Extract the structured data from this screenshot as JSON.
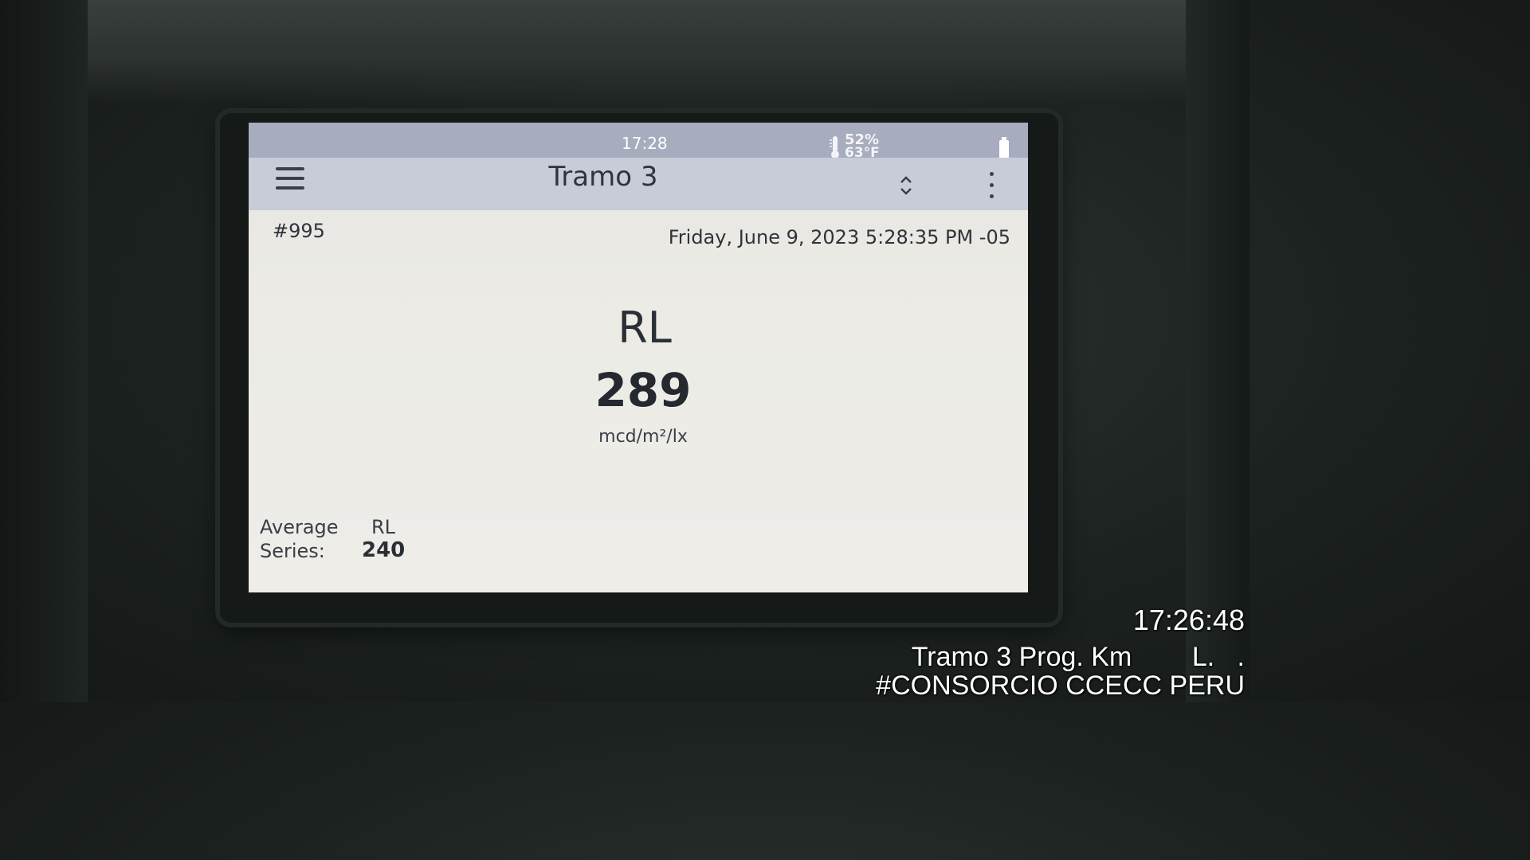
{
  "device": {
    "status_bar": {
      "time": "17:28",
      "humidity": "52%",
      "temperature": "63°F",
      "icons": [
        "thermometer-icon",
        "battery-icon"
      ]
    },
    "app_bar": {
      "title": "Tramo 3",
      "icons": [
        "menu-icon",
        "sort-icon",
        "more-vert-icon"
      ]
    },
    "measurement": {
      "record_id": "#995",
      "timestamp": "Friday, June 9, 2023 5:28:35 PM -05",
      "metric": "RL",
      "value": "289",
      "unit": "mcd/m²/lx"
    },
    "series_average": {
      "label_line1": "Average",
      "label_line2": "Series:",
      "column": "RL",
      "value": "240"
    }
  },
  "photo_overlay": {
    "time": "17:26:48",
    "location": "Tramo 3 Prog. Km        L.   .",
    "tag": "#CONSORCIO CCECC PERU"
  }
}
